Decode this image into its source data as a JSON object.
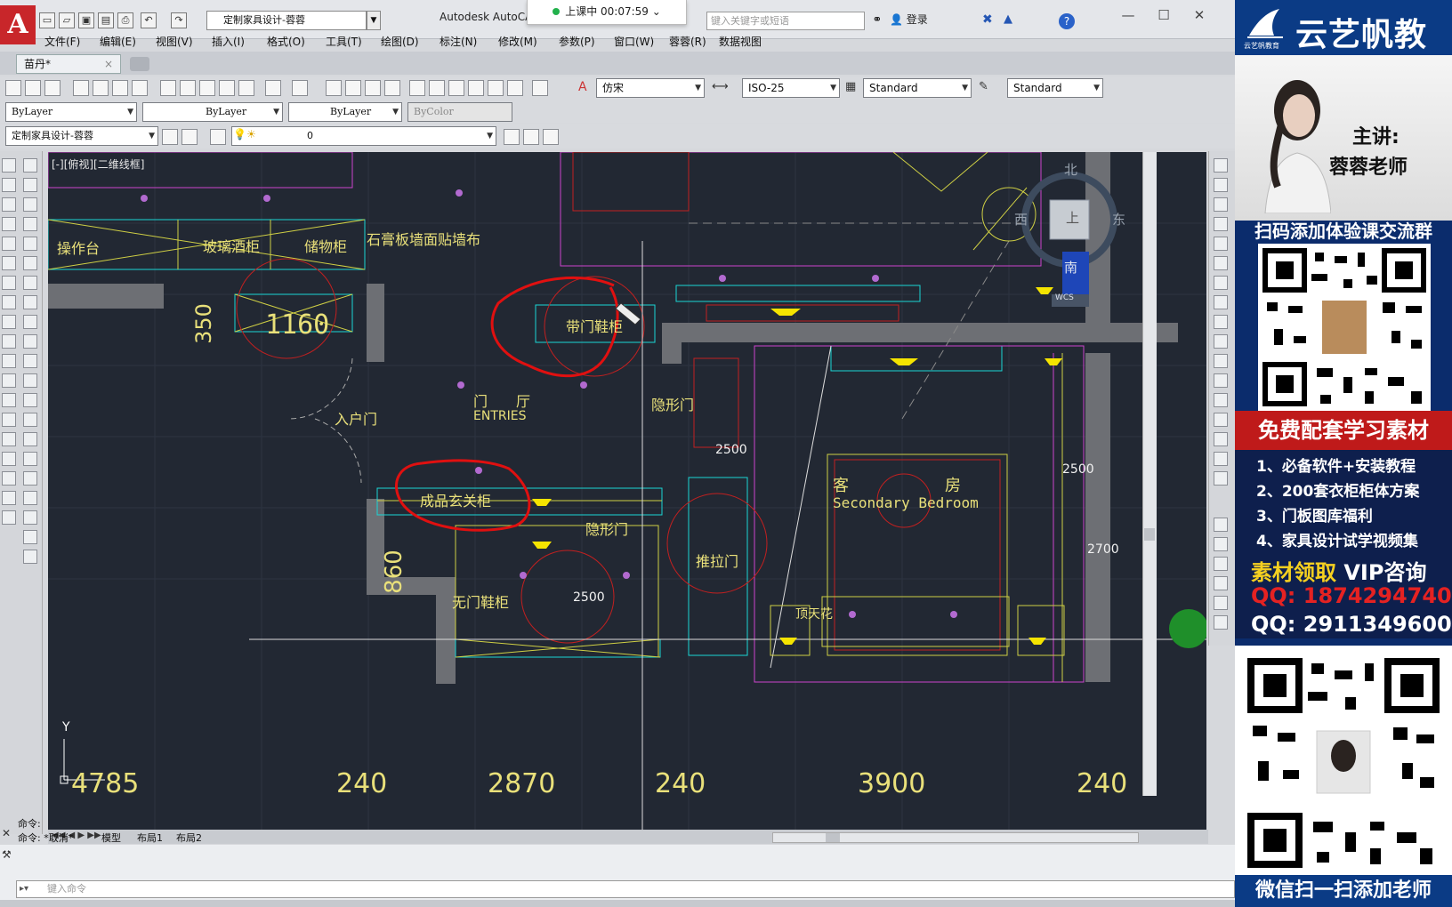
{
  "app": {
    "logo_letter": "A",
    "workspace": "定制家具设计-蓉蓉",
    "title": "Autodesk AutoCA",
    "search_placeholder": "键入关键字或短语",
    "login": "登录",
    "doc_tab": "苗丹*",
    "doc_tab_close": "×"
  },
  "timer": {
    "label": "上课中 00:07:59",
    "caret": "⌄"
  },
  "menus": [
    "文件(F)",
    "编辑(E)",
    "视图(V)",
    "插入(I)",
    "格式(O)",
    "工具(T)",
    "绘图(D)",
    "标注(N)",
    "修改(M)",
    "参数(P)",
    "窗口(W)",
    "蓉蓉(R)",
    "数据视图"
  ],
  "toolbars": {
    "textstyle": "仿宋",
    "dimstyle": "ISO-25",
    "tablestyle": "Standard",
    "mleaderstyle": "Standard",
    "color": "ByLayer",
    "linetype": "ByLayer",
    "lineweight": "ByLayer",
    "plotstyle": "ByColor",
    "workspace2": "定制家具设计-蓉蓉",
    "layer": "0"
  },
  "viewport": {
    "label": "[-][俯视][二维线框]"
  },
  "viewcube": {
    "north": "北",
    "south": "南",
    "east": "东",
    "west": "西",
    "top": "上",
    "wcs": "WCS"
  },
  "drawing": {
    "labels": {
      "czt": "操作台",
      "bljg": "玻璃酒柜",
      "cwg": "储物柜",
      "sgb": "石膏板墙面贴墙布",
      "dmxg": "带门鞋柜",
      "mt": "门　　厅",
      "entries": "ENTRIES",
      "rhm": "入户门",
      "yxm1": "隐形门",
      "cpxg": "成品玄关柜",
      "yxm2": "隐形门",
      "wmxg": "无门鞋柜",
      "tlm": "推拉门",
      "kf": "客　　　　　　房",
      "secondary": "Secondary Bedroom",
      "dth": "顶天花"
    },
    "dims": {
      "d350": "350",
      "d1160": "1160",
      "d860": "860",
      "d2500a": "2500",
      "d2500b": "2500",
      "d2500c": "2500",
      "d2700": "2700",
      "bottom": [
        "4785",
        "240",
        "2870",
        "240",
        "3900",
        "240"
      ]
    },
    "axis_y": "Y"
  },
  "layout_tabs": [
    "模型",
    "布局1",
    "布局2"
  ],
  "command": {
    "line1": "命令:",
    "line2": "命令: *取消*",
    "placeholder": "键入命令"
  },
  "ad": {
    "brand": "云艺帆教育",
    "brand_sub": "云艺帆教育",
    "speaker_1": "主讲:",
    "speaker_2": "蓉蓉老师",
    "scan_group": "扫码添加体验课交流群",
    "free": "免费配套学习素材",
    "items": [
      "1、必备软件+安装教程",
      "2、200套衣柜柜体方案",
      "3、门板图库福利",
      "4、家具设计试学视频集"
    ],
    "vip_left": "素材领取",
    "vip_right": " VIP咨询",
    "qq1": "QQ: 1874294740",
    "qq2": "QQ: 2911349600",
    "wechat": "微信扫一扫添加老师",
    "colors": {
      "panel": "#0b2c6c",
      "red": "#bf1a1a",
      "yellow": "#f5d020"
    }
  }
}
